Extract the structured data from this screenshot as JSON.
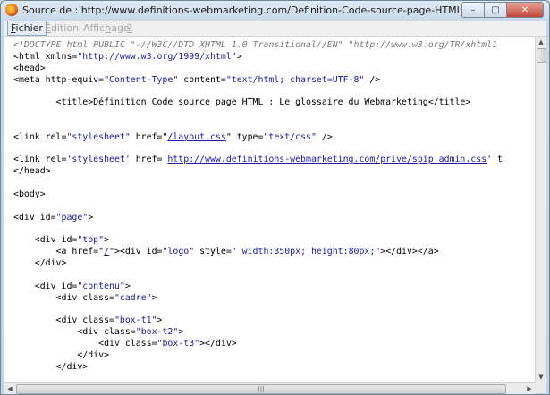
{
  "window": {
    "title": "Source de : http://www.definitions-webmarketing.com/Definition-Code-source-page-HTML - Mozilla Firefox",
    "buttons": {
      "minimize": "–",
      "maximize": "□",
      "close": "✕"
    }
  },
  "menubar": {
    "fichier_prefix": "F",
    "fichier_rest": "ichier",
    "edition_prefix": "É",
    "edition_rest": "dition",
    "affichage_a": "Affic",
    "affichage_h": "h",
    "affichage_b": "age",
    "help": "?"
  },
  "code": {
    "l1": "<!DOCTYPE html PUBLIC \"-//W3C//DTD XHTML 1.0 Transitional//EN\" \"http://www.w3.org/TR/xhtml1",
    "l2_tag": "<html xmlns=",
    "l2_val": "\"http://www.w3.org/1999/xhtml\"",
    "l2_end": ">",
    "l3": "<head>",
    "l4_tag": "<meta http-equiv=",
    "l4_v1": "\"Content-Type\"",
    "l4_a2": " content=",
    "l4_v2": "\"text/html; charset=UTF-8\"",
    "l4_end": " />",
    "l6": "        <title>Définition Code source page HTML : Le glossaire du Webmarketing</title>",
    "l9_a": "<link rel=",
    "l9_v1": "\"stylesheet\"",
    "l9_b": " href=\"",
    "l9_link": "/layout.css",
    "l9_c": "\" type=",
    "l9_v3": "\"text/css\"",
    "l9_end": " />",
    "l11_a": "<link rel=",
    "l11_v1": "'stylesheet'",
    "l11_b": " href='",
    "l11_link": "http://www.definitions-webmarketing.com/prive/spip_admin.css",
    "l11_c": "' t",
    "l12": "</head>",
    "l14": "<body>",
    "l16_a": "<div id=",
    "l16_v": "\"page\"",
    "l16_end": ">",
    "l18_a": "    <div id=",
    "l18_v": "\"top\"",
    "l18_end": ">",
    "l19_a": "        <a href=\"",
    "l19_link": "/",
    "l19_b": "\"><div id=",
    "l19_v1": "\"logo\"",
    "l19_c": " style=",
    "l19_v2": "\" width:350px; height:80px;\"",
    "l19_end": "></div></a>",
    "l20": "    </div>",
    "l22_a": "    <div id=",
    "l22_v": "\"contenu\"",
    "l22_end": ">",
    "l23_a": "        <div class=",
    "l23_v": "\"cadre\"",
    "l23_end": ">",
    "l25_a": "        <div class=",
    "l25_v": "\"box-t1\"",
    "l25_end": ">",
    "l26_a": "            <div class=",
    "l26_v": "\"box-t2\"",
    "l26_end": ">",
    "l27_a": "                <div class=",
    "l27_v": "\"box-t3\"",
    "l27_end": "></div>",
    "l28": "            </div>",
    "l29": "        </div>"
  },
  "scrollbars": {
    "up": "▲",
    "down": "▼",
    "left": "◀",
    "right": "▶",
    "grip": "|||"
  }
}
